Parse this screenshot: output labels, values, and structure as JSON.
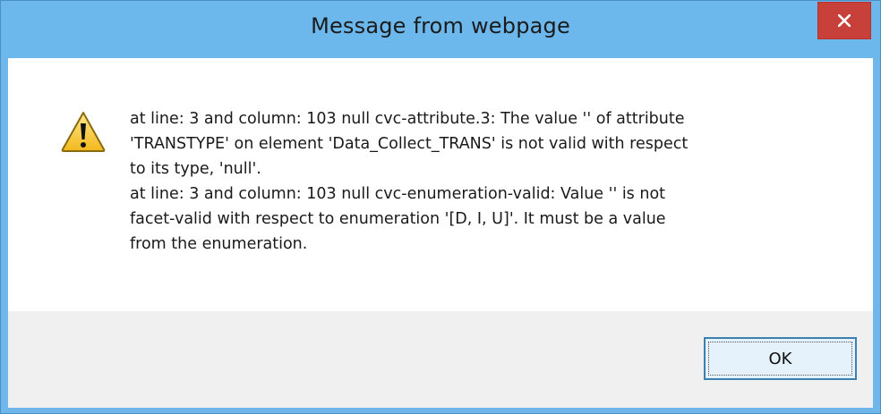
{
  "window": {
    "title": "Message from webpage",
    "close_icon": "close-icon"
  },
  "message": {
    "icon": "warning-icon",
    "lines": [
      "at line: 3 and column: 103 null cvc-attribute.3: The value '' of attribute",
      "'TRANSTYPE' on element 'Data_Collect_TRANS' is not valid with respect",
      "to its type, 'null'.",
      "at line: 3 and column: 103 null cvc-enumeration-valid: Value '' is not",
      "facet-valid with respect to enumeration '[D, I, U]'. It must be a value",
      "from the enumeration."
    ]
  },
  "buttons": {
    "ok_label": "OK"
  },
  "colors": {
    "titlebar": "#6cb8ec",
    "close_button": "#c8403a",
    "button_area": "#f0f0f0",
    "ok_border": "#3c7fb1"
  }
}
